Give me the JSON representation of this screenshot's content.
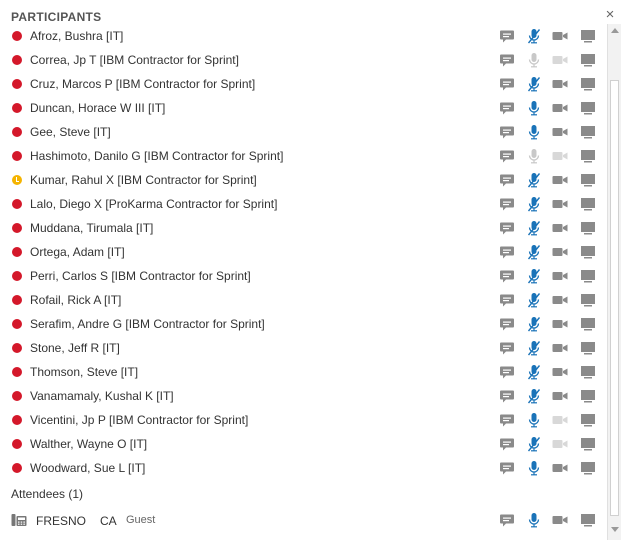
{
  "panel": {
    "title": "PARTICIPANTS",
    "close_glyph": "×"
  },
  "participants": [
    {
      "name": "Afroz, Bushra [IT]",
      "status": "busy",
      "mic": "muted",
      "video": "on"
    },
    {
      "name": "Correa, Jp T [IBM Contractor for Sprint]",
      "status": "busy",
      "mic": "disabled",
      "video": "off"
    },
    {
      "name": "Cruz, Marcos P [IBM Contractor for Sprint]",
      "status": "busy",
      "mic": "muted",
      "video": "on"
    },
    {
      "name": "Duncan, Horace W III [IT]",
      "status": "busy",
      "mic": "active",
      "video": "on"
    },
    {
      "name": "Gee, Steve [IT]",
      "status": "busy",
      "mic": "active",
      "video": "on"
    },
    {
      "name": "Hashimoto, Danilo G [IBM Contractor for Sprint]",
      "status": "busy",
      "mic": "disabled",
      "video": "off"
    },
    {
      "name": "Kumar, Rahul X [IBM Contractor for Sprint]",
      "status": "away",
      "mic": "muted",
      "video": "on"
    },
    {
      "name": "Lalo, Diego X [ProKarma Contractor for Sprint]",
      "status": "busy",
      "mic": "muted",
      "video": "on"
    },
    {
      "name": "Muddana, Tirumala [IT]",
      "status": "busy",
      "mic": "muted",
      "video": "on"
    },
    {
      "name": "Ortega, Adam [IT]",
      "status": "busy",
      "mic": "muted",
      "video": "on"
    },
    {
      "name": "Perri, Carlos S [IBM Contractor for Sprint]",
      "status": "busy",
      "mic": "muted",
      "video": "on"
    },
    {
      "name": "Rofail, Rick A [IT]",
      "status": "busy",
      "mic": "muted",
      "video": "on"
    },
    {
      "name": "Serafim, Andre G [IBM Contractor for Sprint]",
      "status": "busy",
      "mic": "muted",
      "video": "on"
    },
    {
      "name": "Stone, Jeff R [IT]",
      "status": "busy",
      "mic": "muted",
      "video": "on"
    },
    {
      "name": "Thomson, Steve [IT]",
      "status": "busy",
      "mic": "muted",
      "video": "on"
    },
    {
      "name": "Vanamamaly, Kushal K [IT]",
      "status": "busy",
      "mic": "muted",
      "video": "on"
    },
    {
      "name": "Vicentini, Jp P [IBM Contractor for Sprint]",
      "status": "busy",
      "mic": "active",
      "video": "off"
    },
    {
      "name": "Walther, Wayne O [IT]",
      "status": "busy",
      "mic": "muted",
      "video": "off"
    },
    {
      "name": "Woodward, Sue L [IT]",
      "status": "busy",
      "mic": "active",
      "video": "on"
    }
  ],
  "attendees": {
    "section_label": "Attendees (1)",
    "items": [
      {
        "name": "FRESNO",
        "location": "CA",
        "role": "Guest",
        "mic": "active",
        "video": "on"
      }
    ]
  },
  "colors": {
    "mic_active": "#1a73b8",
    "icon_gray": "#8a8a8a",
    "icon_faded": "#d8d8d8",
    "busy": "#d4182a",
    "away": "#f5b400"
  },
  "icons": {
    "chat": "chat-bubble-icon",
    "mic": "microphone-icon",
    "video": "video-camera-icon",
    "screen": "monitor-icon",
    "phone": "desk-phone-icon"
  }
}
